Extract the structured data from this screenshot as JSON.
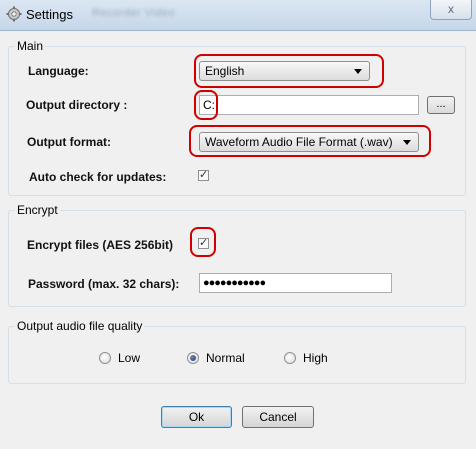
{
  "window": {
    "title": "Settings",
    "blurred_tab_text": "Recorder Video",
    "close_glyph": "x",
    "icon": "gear-icon"
  },
  "main": {
    "legend": "Main",
    "language_label": "Language:",
    "language_value": "English",
    "output_dir_label": "Output directory :",
    "output_dir_value": "C:",
    "browse_label": "...",
    "output_format_label": "Output format:",
    "output_format_value": "Waveform Audio File Format (.wav)",
    "auto_check_label": "Auto check for updates:",
    "auto_check_checked": true
  },
  "encrypt": {
    "legend": "Encrypt",
    "encrypt_label": "Encrypt files (AES 256bit)",
    "encrypt_checked": true,
    "password_label": "Password (max. 32 chars):",
    "password_value": "●●●●●●●●●●●"
  },
  "quality": {
    "legend": "Output audio file quality",
    "options": [
      "Low",
      "Normal",
      "High"
    ],
    "selected": "Normal"
  },
  "buttons": {
    "ok": "Ok",
    "cancel": "Cancel"
  },
  "colors": {
    "highlight": "#d00000",
    "titlebar": "#c6d7ea",
    "background": "#f0f0f0"
  }
}
